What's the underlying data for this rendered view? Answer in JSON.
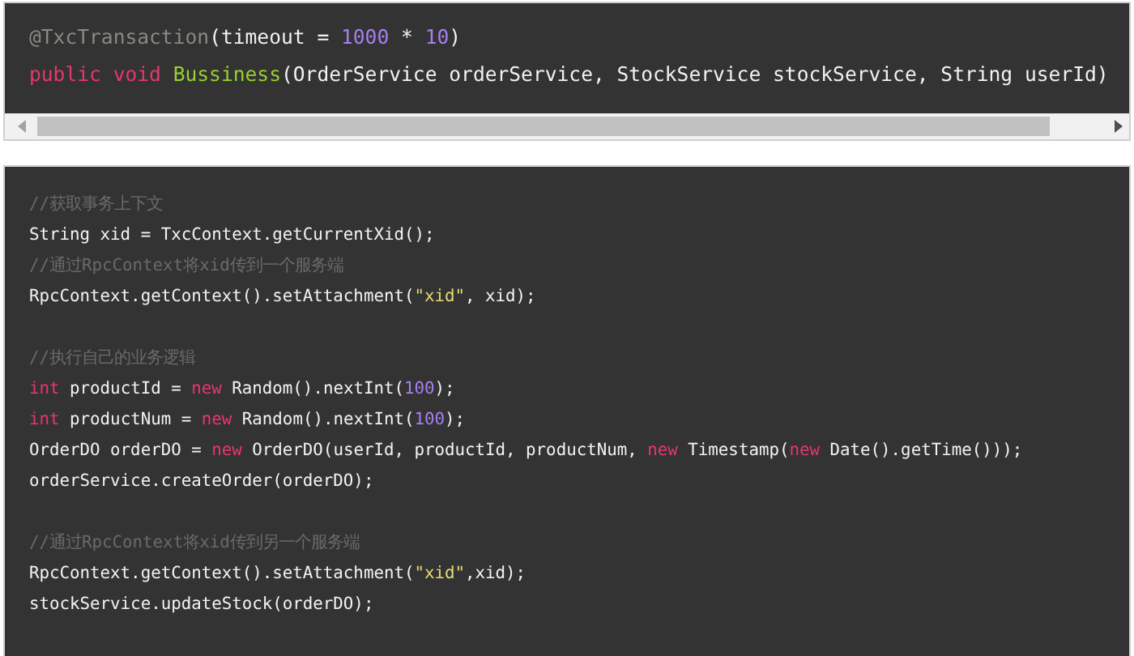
{
  "code_blocks": [
    {
      "scrollbar": true,
      "lines": [
        {
          "kind": "code",
          "tokens": [
            {
              "t": "@TxcTransaction",
              "kind": "annotation"
            },
            {
              "t": "(timeout = ",
              "kind": "plain"
            },
            {
              "t": "1000",
              "kind": "number"
            },
            {
              "t": " * ",
              "kind": "plain"
            },
            {
              "t": "10",
              "kind": "number"
            },
            {
              "t": ")",
              "kind": "plain"
            }
          ]
        },
        {
          "kind": "code",
          "tokens": [
            {
              "t": "public void ",
              "kind": "keyword"
            },
            {
              "t": "Bussiness",
              "kind": "function"
            },
            {
              "t": "(OrderService orderService, StockService stockService, String userId)",
              "kind": "plain"
            }
          ]
        }
      ]
    },
    {
      "scrollbar": false,
      "lines": [
        {
          "kind": "code",
          "tokens": [
            {
              "t": "//获取事务上下文",
              "kind": "comment"
            }
          ]
        },
        {
          "kind": "code",
          "tokens": [
            {
              "t": "String xid = TxcContext.getCurrentXid();",
              "kind": "plain"
            }
          ]
        },
        {
          "kind": "code",
          "tokens": [
            {
              "t": "//通过RpcContext将xid传到一个服务端",
              "kind": "comment"
            }
          ]
        },
        {
          "kind": "code",
          "tokens": [
            {
              "t": "RpcContext.getContext().setAttachment(",
              "kind": "plain"
            },
            {
              "t": "\"xid\"",
              "kind": "string"
            },
            {
              "t": ", xid);",
              "kind": "plain"
            }
          ]
        },
        {
          "kind": "blank"
        },
        {
          "kind": "code",
          "tokens": [
            {
              "t": "//执行自己的业务逻辑",
              "kind": "comment"
            }
          ]
        },
        {
          "kind": "code",
          "tokens": [
            {
              "t": "int",
              "kind": "keyword"
            },
            {
              "t": " productId = ",
              "kind": "plain"
            },
            {
              "t": "new",
              "kind": "keyword"
            },
            {
              "t": " Random().nextInt(",
              "kind": "plain"
            },
            {
              "t": "100",
              "kind": "number"
            },
            {
              "t": ");",
              "kind": "plain"
            }
          ]
        },
        {
          "kind": "code",
          "tokens": [
            {
              "t": "int",
              "kind": "keyword"
            },
            {
              "t": " productNum = ",
              "kind": "plain"
            },
            {
              "t": "new",
              "kind": "keyword"
            },
            {
              "t": " Random().nextInt(",
              "kind": "plain"
            },
            {
              "t": "100",
              "kind": "number"
            },
            {
              "t": ");",
              "kind": "plain"
            }
          ]
        },
        {
          "kind": "code",
          "tokens": [
            {
              "t": "OrderDO orderDO = ",
              "kind": "plain"
            },
            {
              "t": "new",
              "kind": "keyword"
            },
            {
              "t": " OrderDO(userId, productId, productNum, ",
              "kind": "plain"
            },
            {
              "t": "new",
              "kind": "keyword"
            },
            {
              "t": " Timestamp(",
              "kind": "plain"
            },
            {
              "t": "new",
              "kind": "keyword"
            },
            {
              "t": " Date().getTime()));",
              "kind": "plain"
            }
          ]
        },
        {
          "kind": "code",
          "tokens": [
            {
              "t": "orderService.createOrder(orderDO);",
              "kind": "plain"
            }
          ]
        },
        {
          "kind": "blank"
        },
        {
          "kind": "code",
          "tokens": [
            {
              "t": "//通过RpcContext将xid传到另一个服务端",
              "kind": "comment"
            }
          ]
        },
        {
          "kind": "code",
          "tokens": [
            {
              "t": "RpcContext.getContext().setAttachment(",
              "kind": "plain"
            },
            {
              "t": "\"xid\"",
              "kind": "string"
            },
            {
              "t": ",xid);",
              "kind": "plain"
            }
          ]
        },
        {
          "kind": "code",
          "tokens": [
            {
              "t": "stockService.updateStock(orderDO);",
              "kind": "plain"
            }
          ]
        }
      ]
    }
  ]
}
